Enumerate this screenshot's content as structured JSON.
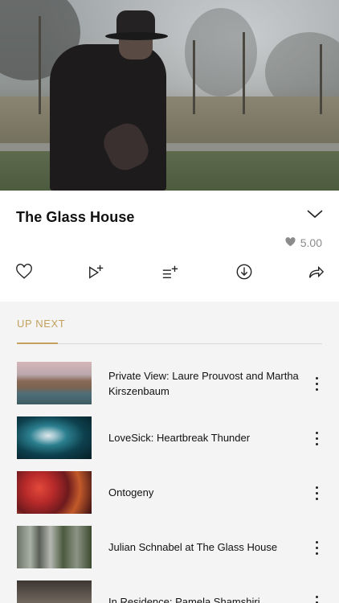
{
  "video": {
    "title": "The Glass House",
    "rating": "5.00"
  },
  "actions": [
    {
      "name": "like-button",
      "icon": "heart-icon"
    },
    {
      "name": "play-next-button",
      "icon": "play-add-icon"
    },
    {
      "name": "add-to-queue-button",
      "icon": "queue-add-icon"
    },
    {
      "name": "download-button",
      "icon": "download-icon"
    },
    {
      "name": "share-button",
      "icon": "share-icon"
    }
  ],
  "up_next": {
    "label": "UP NEXT",
    "items": [
      {
        "title": "Private View: Laure Prouvost and Martha Kirszenbaum"
      },
      {
        "title": "LoveSick: Heartbreak Thunder"
      },
      {
        "title": "Ontogeny"
      },
      {
        "title": "Julian Schnabel at The Glass House"
      },
      {
        "title": "In Residence: Pamela Shamshiri"
      }
    ]
  },
  "colors": {
    "accent": "#c4a15d",
    "rating": "#8b8b8b",
    "background": "#f4f4f4"
  }
}
